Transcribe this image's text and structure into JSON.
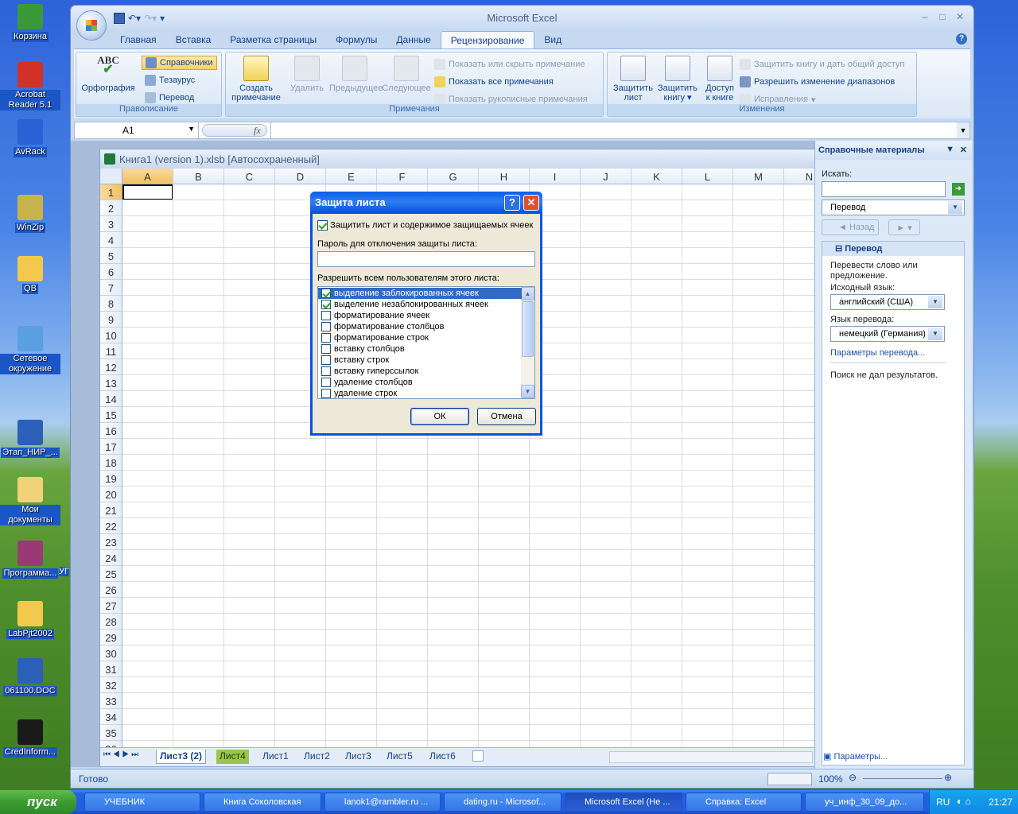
{
  "desktop": {
    "icons": [
      {
        "label": "Корзина",
        "color": "#3a9a3a"
      },
      {
        "label": "Acrobat Reader 5.1",
        "color": "#d23127"
      },
      {
        "label": "AvRack",
        "color": "#2a62d6"
      },
      {
        "label": "WinZip",
        "color": "#c6b34a"
      },
      {
        "label": "QB",
        "color": "#f2c94c"
      },
      {
        "label": "Сетевое окружение",
        "color": "#5aa0e0"
      },
      {
        "label": "Этап_НИР_...",
        "color": "#2b5fb8"
      },
      {
        "label": "Мои документы",
        "color": "#f0d27a"
      },
      {
        "label": "Программа...",
        "color": "#9a3a74"
      },
      {
        "label": "LabPjt2002",
        "color": "#f2c94c"
      },
      {
        "label": "061100.DOC",
        "color": "#2b5fb8"
      },
      {
        "label": "CredInform...",
        "color": "#1a1a1a"
      }
    ],
    "partial_label": "УГ"
  },
  "window": {
    "title": "Microsoft Excel"
  },
  "ribbon": {
    "tabs": [
      "Главная",
      "Вставка",
      "Разметка страницы",
      "Формулы",
      "Данные",
      "Рецензирование",
      "Вид"
    ],
    "active_tab": "Рецензирование",
    "groups": {
      "proofing": {
        "name": "Правописание",
        "spelling": "Орфография",
        "research": "Справочники",
        "thesaurus": "Тезаурус",
        "translate": "Перевод"
      },
      "comments": {
        "name": "Примечания",
        "new": "Создать примечание",
        "new_l1": "Создать",
        "new_l2": "примечание",
        "delete": "Удалить",
        "previous": "Предыдущее",
        "next": "Следующее",
        "show_hide": "Показать или скрыть примечание",
        "show_all": "Показать все примечания",
        "show_ink": "Показать рукописные примечания"
      },
      "changes": {
        "name": "Изменения",
        "protect_sheet_l1": "Защитить",
        "protect_sheet_l2": "лист",
        "protect_book_l1": "Защитить",
        "protect_book_l2": "книгу",
        "share_l1": "Доступ",
        "share_l2": "к книге",
        "protect_share": "Защитить книгу и дать общий доступ",
        "allow_ranges": "Разрешить изменение диапазонов",
        "track": "Исправления"
      }
    }
  },
  "formula_bar": {
    "name_box": "A1",
    "fx": "fx",
    "value": ""
  },
  "workbook": {
    "title": "Книга1 (version 1).xlsb [Автосохраненный]",
    "columns": [
      "A",
      "B",
      "C",
      "D",
      "E",
      "F",
      "G",
      "H",
      "I",
      "J",
      "K",
      "L",
      "M",
      "N"
    ],
    "rows": [
      "1",
      "2",
      "3",
      "4",
      "5",
      "6",
      "7",
      "8",
      "9",
      "10",
      "11",
      "12",
      "13",
      "14",
      "15",
      "16",
      "17",
      "18",
      "19",
      "20",
      "21",
      "22",
      "23",
      "24",
      "25",
      "26",
      "27",
      "28",
      "29",
      "30",
      "31",
      "32",
      "33",
      "34",
      "35",
      "36"
    ],
    "sheets": [
      "Лист3 (2)",
      "Лист4",
      "Лист1",
      "Лист2",
      "Лист3",
      "Лист5",
      "Лист6"
    ],
    "active_sheet": "Лист3 (2)"
  },
  "status": {
    "ready": "Готово",
    "zoom": "100%"
  },
  "research_pane": {
    "title": "Справочные материалы",
    "search_label": "Искать:",
    "search_value": "",
    "source": "Перевод",
    "back": "Назад",
    "section": "Перевод",
    "description": "Перевести слово или предложение.",
    "from_label": "Исходный язык:",
    "from_value": "английский (США)",
    "to_label": "Язык перевода:",
    "to_value": "немецкий (Германия)",
    "options_link": "Параметры перевода...",
    "no_results": "Поиск не дал результатов.",
    "params": "Параметры..."
  },
  "dialog": {
    "title": "Защита листа",
    "protect_check": "Защитить лист и содержимое защищаемых ячеек",
    "protect_checked": true,
    "password_label": "Пароль для отключения защиты листа:",
    "password_value": "",
    "allow_label": "Разрешить всем пользователям этого листа:",
    "items": [
      {
        "label": "выделение заблокированных ячеек",
        "checked": true
      },
      {
        "label": "выделение незаблокированных ячеек",
        "checked": true
      },
      {
        "label": "форматирование ячеек",
        "checked": false
      },
      {
        "label": "форматирование столбцов",
        "checked": false
      },
      {
        "label": "форматирование строк",
        "checked": false
      },
      {
        "label": "вставку столбцов",
        "checked": false
      },
      {
        "label": "вставку строк",
        "checked": false
      },
      {
        "label": "вставку гиперссылок",
        "checked": false
      },
      {
        "label": "удаление столбцов",
        "checked": false
      },
      {
        "label": "удаление строк",
        "checked": false
      }
    ],
    "ok": "ОК",
    "cancel": "Отмена",
    "help": "?",
    "close": "✕"
  },
  "taskbar": {
    "start": "пуск",
    "items": [
      "УЧЕБНИК",
      "Книга Соколовская",
      "lanok1@rambler.ru ...",
      "dating.ru - Microsof...",
      "Microsoft Excel (Не ...",
      "Справка: Excel",
      "уч_инф_30_09_до..."
    ],
    "active_index": 4,
    "lang": "RU",
    "time": "21:27"
  },
  "colors": {
    "accent": "#0054e3",
    "ribbon_text": "#15428b",
    "selection": "#316ac5"
  }
}
